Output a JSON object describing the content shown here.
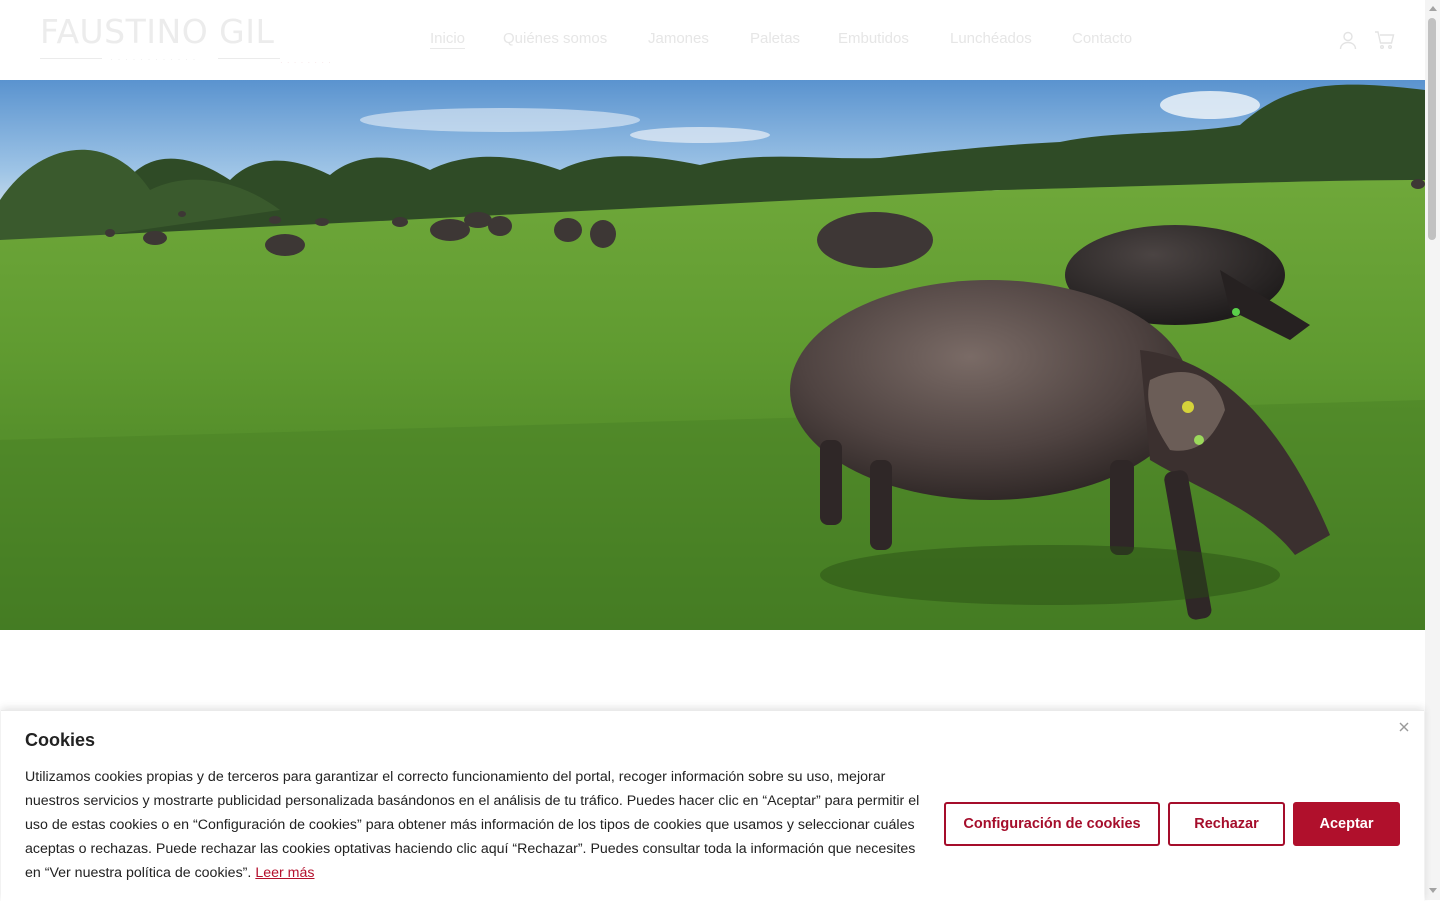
{
  "header": {
    "logo": {
      "name": "FAUSTINO GIL",
      "subtitle": "· · · · · · · · · · · ·",
      "tagline": "· · · · · · · ·"
    },
    "nav": [
      {
        "label": "Inicio",
        "active": true
      },
      {
        "label": "Quiénes somos"
      },
      {
        "label": "Jamones"
      },
      {
        "label": "Paletas"
      },
      {
        "label": "Embutidos"
      },
      {
        "label": "Lunchéados"
      },
      {
        "label": "Contacto"
      }
    ],
    "icons": {
      "account": "user-icon",
      "cart": "cart-icon"
    }
  },
  "hero": {
    "scene": "iberian-pigs-in-dehesa"
  },
  "cookies": {
    "title": "Cookies",
    "body": "Utilizamos cookies propias y de terceros para garantizar el correcto funcionamiento del portal, recoger información sobre su uso, mejorar nuestros servicios y mostrarte publicidad personalizada basándonos en el análisis de tu tráfico. Puedes hacer clic en “Aceptar” para permitir el uso de estas cookies o en “Configuración de cookies” para obtener más información de los tipos de cookies que usamos y seleccionar cuáles aceptas o rechazas. Puede rechazar las cookies optativas haciendo clic aquí “Rechazar”. Puedes consultar toda la información que necesites en “Ver nuestra política de cookies”.",
    "read_more": "Leer más",
    "buttons": {
      "config": "Configuración de cookies",
      "reject": "Rechazar",
      "accept": "Aceptar"
    }
  },
  "colors": {
    "brand": "#b0102c",
    "text": "#222222"
  }
}
